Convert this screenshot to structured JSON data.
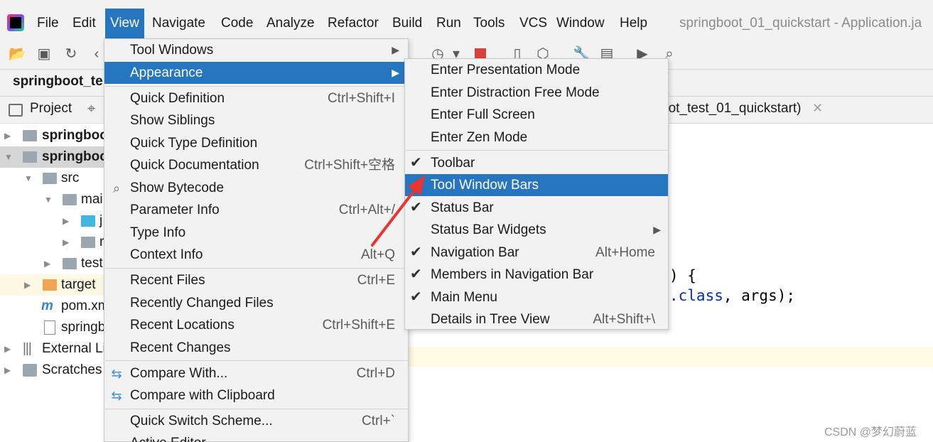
{
  "menubar": {
    "items": [
      "File",
      "Edit",
      "View",
      "Navigate",
      "Code",
      "Analyze",
      "Refactor",
      "Build",
      "Run",
      "Tools",
      "VCS",
      "Window",
      "Help"
    ],
    "project_title": "springboot_01_quickstart - Application.ja"
  },
  "navbar": {
    "crumb": "springboot_te"
  },
  "project_panel": {
    "label": "Project",
    "tree": [
      "springboo",
      "springboo",
      "src",
      "mai",
      "j",
      "r",
      "test",
      "target",
      "pom.xm",
      "springb",
      "External Li",
      "Scratches"
    ]
  },
  "editor": {
    "tab_label": "oot_test_01_quickstart)",
    "code_line1": ") {",
    "code_line2_kw": ".class",
    "code_line2_rest": ", args);"
  },
  "view_menu": {
    "tool_windows": "Tool Windows",
    "appearance": "Appearance",
    "quick_definition": "Quick Definition",
    "quick_definition_sc": "Ctrl+Shift+I",
    "show_siblings": "Show Siblings",
    "quick_type_definition": "Quick Type Definition",
    "quick_documentation": "Quick Documentation",
    "quick_documentation_sc": "Ctrl+Shift+空格",
    "show_bytecode": "Show Bytecode",
    "parameter_info": "Parameter Info",
    "parameter_info_sc": "Ctrl+Alt+/",
    "type_info": "Type Info",
    "context_info": "Context Info",
    "context_info_sc": "Alt+Q",
    "recent_files": "Recent Files",
    "recent_files_sc": "Ctrl+E",
    "recently_changed_files": "Recently Changed Files",
    "recent_locations": "Recent Locations",
    "recent_locations_sc": "Ctrl+Shift+E",
    "recent_changes": "Recent Changes",
    "compare_with": "Compare With...",
    "compare_with_sc": "Ctrl+D",
    "compare_clipboard": "Compare with Clipboard",
    "quick_switch_scheme": "Quick Switch Scheme...",
    "quick_switch_scheme_sc": "Ctrl+`",
    "active_editor": "Active Editor"
  },
  "appearance_menu": {
    "presentation_mode": "Enter Presentation Mode",
    "distraction_free": "Enter Distraction Free Mode",
    "full_screen": "Enter Full Screen",
    "zen_mode": "Enter Zen Mode",
    "toolbar": "Toolbar",
    "tool_window_bars": "Tool Window Bars",
    "status_bar": "Status Bar",
    "status_bar_widgets": "Status Bar Widgets",
    "navigation_bar": "Navigation Bar",
    "navigation_bar_sc": "Alt+Home",
    "members_nav_bar": "Members in Navigation Bar",
    "main_menu": "Main Menu",
    "details_tree_view": "Details in Tree View",
    "details_tree_view_sc": "Alt+Shift+\\"
  },
  "watermark": "CSDN @梦幻蔚蓝",
  "colors": {
    "selection": "#2675bf",
    "annotation_arrow": "#e8352f"
  }
}
